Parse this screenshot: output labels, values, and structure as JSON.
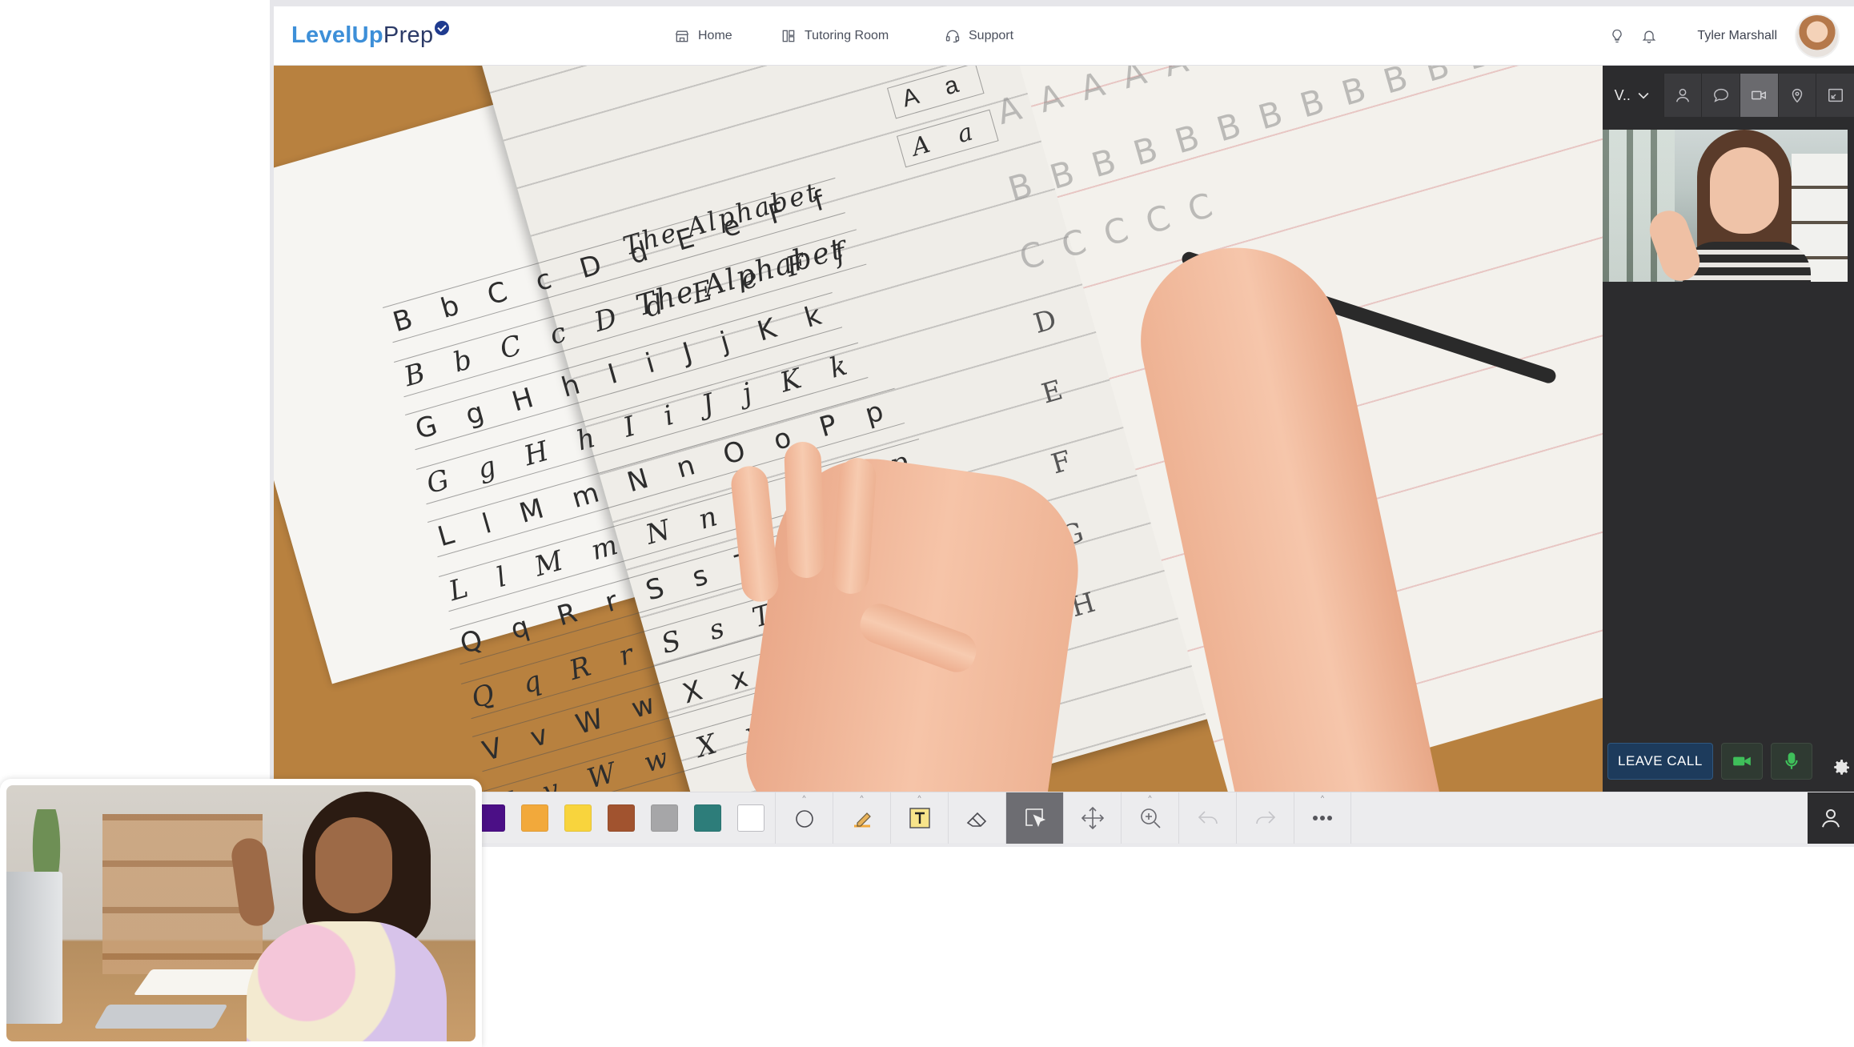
{
  "brand": {
    "name_part1": "LevelUp",
    "name_part2": "Prep"
  },
  "nav": {
    "home": "Home",
    "tutoring_room": "Tutoring Room",
    "support": "Support"
  },
  "header": {
    "user_name": "Tyler Marshall"
  },
  "worksheet": {
    "title_print": "The Alphabet",
    "title_cursive": "The Alphabet",
    "aa_print": "A a",
    "aa_cursive": "A a",
    "rows_print": [
      "B b C c D d E e F f",
      "G g H h I i J j K k",
      "L l M m N n O o P p",
      "Q q R r S s T t U u",
      "V v W w X x Y y Z z"
    ],
    "rows_cursive": [
      "B b C c D d E e F f",
      "G g H h I i J j K k",
      "L l M m N n O o P p",
      "Q q R r S s T t U u",
      "V v W w X x Y y Z z"
    ],
    "trace_rows": [
      "A A A A A",
      "B B B B B B B B B B B B",
      "C C C C C",
      "D",
      "E",
      "F",
      "G",
      "H"
    ]
  },
  "video_panel": {
    "view_select": "V..",
    "tabs": [
      "participants",
      "chat",
      "video",
      "location",
      "expand"
    ],
    "leave_call": "LEAVE CALL"
  },
  "toolbar": {
    "colors": [
      "#4b0f86",
      "#f2a93b",
      "#f8d43d",
      "#a1532f",
      "#a6a6a8",
      "#2d7d7a",
      "#ffffff"
    ],
    "tools": [
      "circle",
      "highlighter",
      "text",
      "eraser",
      "select",
      "move",
      "zoom",
      "undo",
      "redo",
      "more"
    ],
    "active_tool": "select"
  }
}
